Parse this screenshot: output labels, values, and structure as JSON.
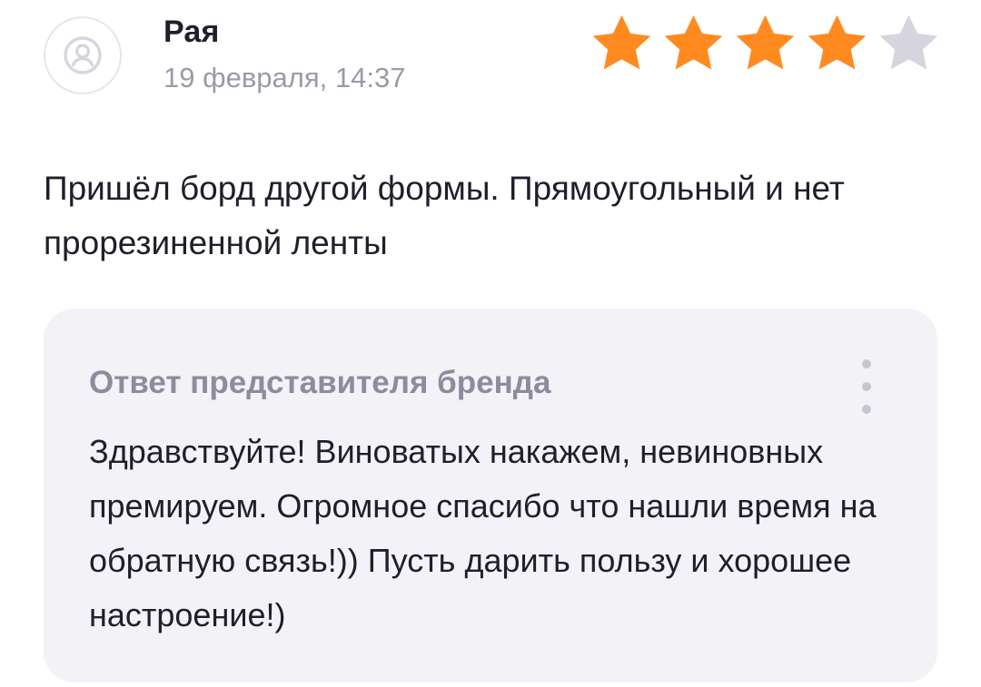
{
  "review": {
    "author_name": "Рая",
    "date": "19 февраля, 14:37",
    "rating": {
      "value": 4,
      "max": 5
    },
    "text": "Пришёл борд другой формы. Прямоугольный и нет прорезиненной ленты"
  },
  "brand_reply": {
    "title": "Ответ представителя бренда",
    "text": "Здравствуйте! Виноватых накажем, невиновных премируем. Огромное спасибо что нашли время на обратную связь!)) Пусть дарить пользу и хорошее настроение!)"
  },
  "icons": {
    "avatar": "user-placeholder-icon",
    "rating_star": "star-icon",
    "more": "more-vertical-icon"
  },
  "colors": {
    "star_filled": "#FF8A1F",
    "star_empty": "#D6D5DF",
    "reply_background": "#F3F2F7",
    "reply_title": "#8E8C9C",
    "muted_text": "#9B9AA6"
  }
}
